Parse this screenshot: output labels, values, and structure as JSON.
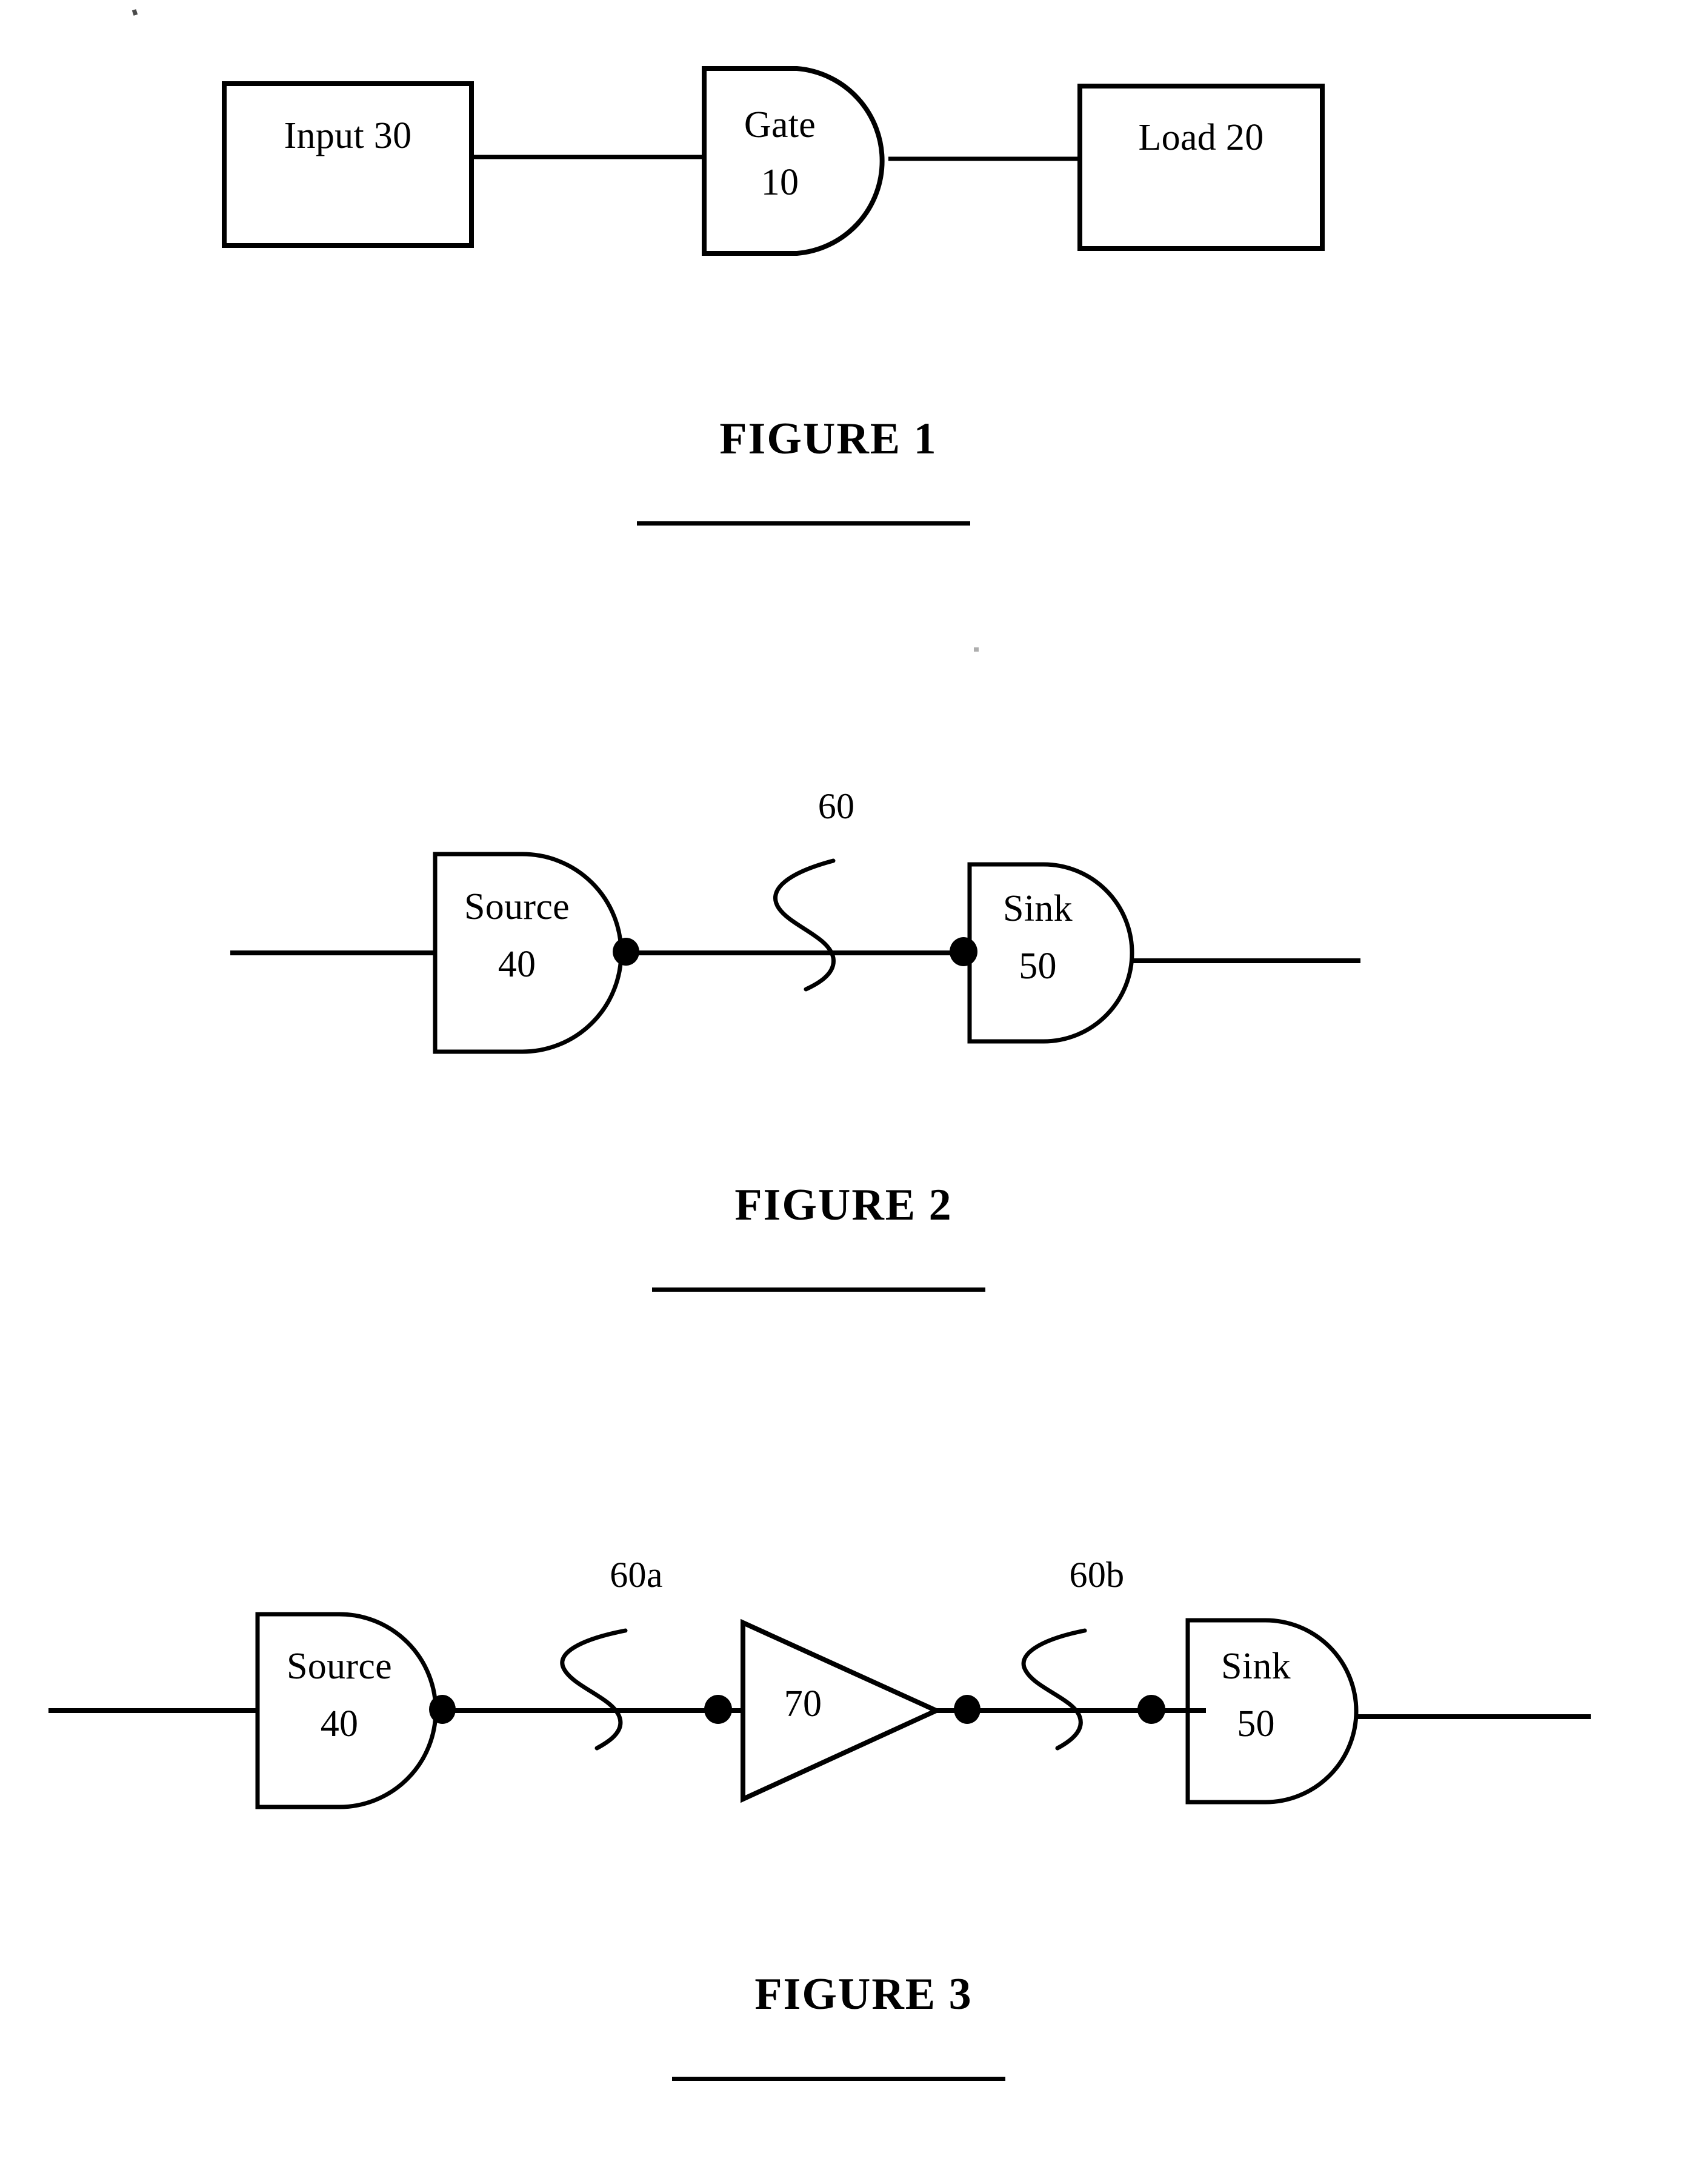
{
  "document": {
    "type": "patent-drawing-sheet",
    "background_color": "#ffffff",
    "ink_color": "#000000"
  },
  "figures": [
    {
      "id": "figure-1",
      "caption": "FIGURE 1",
      "nodes": [
        {
          "id": "input-30",
          "shape": "rectangle",
          "label": "Input 30"
        },
        {
          "id": "gate-10",
          "shape": "and-gate",
          "label_line1": "Gate",
          "label_line2": "10"
        },
        {
          "id": "load-20",
          "shape": "rectangle",
          "label": "Load 20"
        }
      ],
      "connections": [
        {
          "from": "input-30",
          "to": "gate-10"
        },
        {
          "from": "gate-10",
          "to": "load-20"
        }
      ]
    },
    {
      "id": "figure-2",
      "caption": "FIGURE 2",
      "nodes": [
        {
          "id": "source-40",
          "shape": "and-gate",
          "label_line1": "Source",
          "label_line2": "40"
        },
        {
          "id": "sink-50",
          "shape": "and-gate",
          "label_line1": "Sink",
          "label_line2": "50"
        }
      ],
      "net_labels": [
        {
          "id": "net-60",
          "text": "60",
          "leader": "squiggle"
        }
      ],
      "terminal_dots": 2
    },
    {
      "id": "figure-3",
      "caption": "FIGURE 3",
      "nodes": [
        {
          "id": "source-40",
          "shape": "and-gate",
          "label_line1": "Source",
          "label_line2": "40"
        },
        {
          "id": "buffer-70",
          "shape": "triangle",
          "label": "70"
        },
        {
          "id": "sink-50",
          "shape": "and-gate",
          "label_line1": "Sink",
          "label_line2": "50"
        }
      ],
      "net_labels": [
        {
          "id": "net-60a",
          "text": "60a",
          "leader": "squiggle"
        },
        {
          "id": "net-60b",
          "text": "60b",
          "leader": "squiggle"
        }
      ],
      "terminal_dots": 4
    }
  ]
}
